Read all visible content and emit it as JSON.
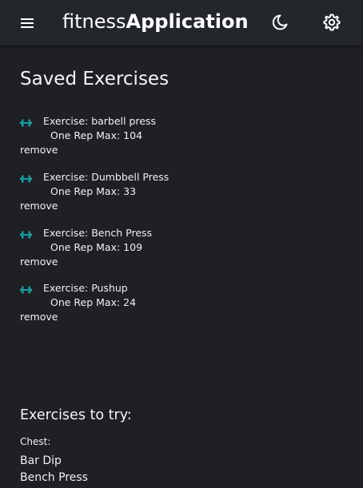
{
  "header": {
    "brand_light": "fitness",
    "brand_bold": "Application",
    "menu_icon": "hamburger-menu-icon",
    "theme_icon": "moon-icon",
    "settings_icon": "gear-icon"
  },
  "saved": {
    "title": "Saved Exercises",
    "items": [
      {
        "name": "Exercise: barbell press",
        "orm": "One Rep Max: 104",
        "remove": "remove"
      },
      {
        "name": "Exercise: Dumbbell Press",
        "orm": "One Rep Max: 33",
        "remove": "remove"
      },
      {
        "name": "Exercise: Bench Press",
        "orm": "One Rep Max: 109",
        "remove": "remove"
      },
      {
        "name": "Exercise: Pushup",
        "orm": "One Rep Max: 24",
        "remove": "remove"
      }
    ]
  },
  "try": {
    "title": "Exercises to try:",
    "category": "Chest:",
    "items": [
      "Bar Dip",
      "Bench Press"
    ]
  },
  "colors": {
    "background": "#1e2024",
    "appbar": "#23262b",
    "accent": "#1a9aa0",
    "text": "#f1f1f1"
  }
}
